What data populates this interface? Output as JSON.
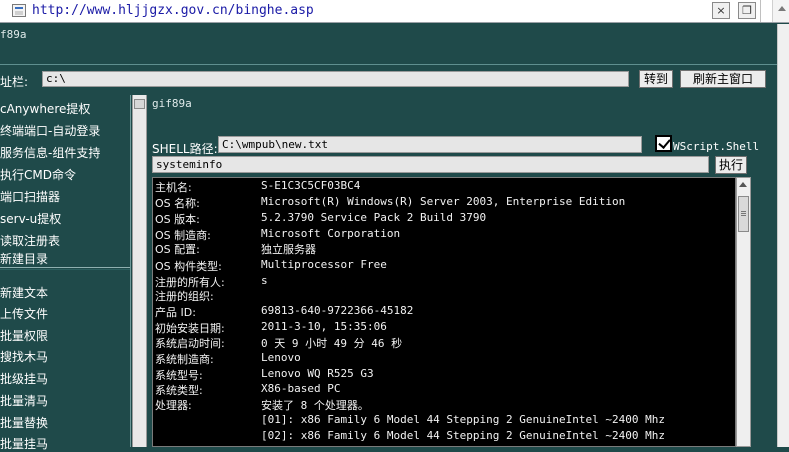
{
  "browser": {
    "url": "http://www.hljjgzx.gov.cn/binghe.asp",
    "close_label": "×",
    "restore_label": "❐"
  },
  "title": "f89a",
  "path_bar": {
    "label": "址栏:",
    "value": "c:\\",
    "go_label": "转到",
    "refresh_label": "刷新主窗口"
  },
  "sidebar": {
    "items": [
      {
        "label": "cAnywhere提权"
      },
      {
        "label": "终端端口-自动登录"
      },
      {
        "label": "服务信息-组件支持"
      },
      {
        "label": "执行CMD命令"
      },
      {
        "label": "端口扫描器"
      },
      {
        "label": "serv-u提权"
      },
      {
        "label": "读取注册表"
      },
      {
        "label": "新建目录"
      },
      {
        "label": "新建文本"
      },
      {
        "label": "上传文件"
      },
      {
        "label": "批量权限"
      },
      {
        "label": "搜找木马"
      },
      {
        "label": "批级挂马"
      },
      {
        "label": "批量清马"
      },
      {
        "label": "批量替换"
      },
      {
        "label": "批量挂马"
      }
    ]
  },
  "content": {
    "gif_label": "gif89a",
    "shell_path_label": "SHELL路径:",
    "shell_path_value": "C:\\wmpub\\new.txt",
    "wscript_label": "WScript.Shell",
    "wscript_checked": true,
    "command_value": "systeminfo",
    "execute_label": "执行"
  },
  "output": {
    "lines": [
      {
        "key": "主机名:",
        "value": "S-E1C3C5CF03BC4"
      },
      {
        "key": "OS 名称:",
        "value": "Microsoft(R) Windows(R) Server 2003, Enterprise Edition"
      },
      {
        "key": "OS 版本:",
        "value": "5.2.3790 Service Pack 2 Build 3790"
      },
      {
        "key": "OS 制造商:",
        "value": "Microsoft Corporation"
      },
      {
        "key": "OS 配置:",
        "value": "独立服务器"
      },
      {
        "key": "OS 构件类型:",
        "value": "Multiprocessor Free"
      },
      {
        "key": "注册的所有人:",
        "value": "s"
      },
      {
        "key": "注册的组织:",
        "value": ""
      },
      {
        "key": "产品 ID:",
        "value": "69813-640-9722366-45182"
      },
      {
        "key": "初始安装日期:",
        "value": "2011-3-10, 15:35:06"
      },
      {
        "key": "系统启动时间:",
        "value": "0 天 9 小时 49 分 46 秒"
      },
      {
        "key": "系统制造商:",
        "value": "Lenovo"
      },
      {
        "key": "系统型号:",
        "value": "Lenovo WQ R525 G3"
      },
      {
        "key": "系统类型:",
        "value": "X86-based PC"
      },
      {
        "key": "处理器:",
        "value": "安装了 8 个处理器。"
      },
      {
        "key": "",
        "value": "[01]: x86 Family 6 Model 44 Stepping 2 GenuineIntel ~2400 Mhz"
      },
      {
        "key": "",
        "value": "[02]: x86 Family 6 Model 44 Stepping 2 GenuineIntel ~2400 Mhz"
      }
    ]
  }
}
